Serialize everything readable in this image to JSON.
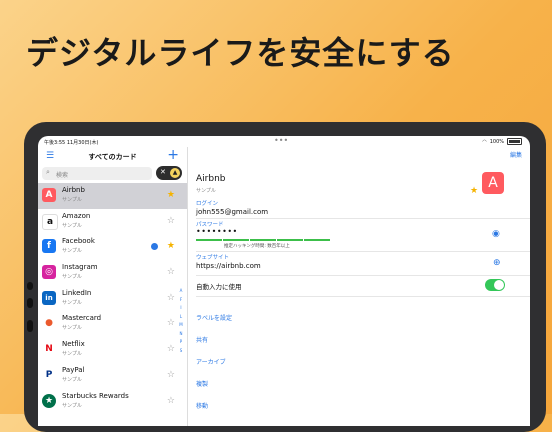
{
  "headline": "デジタルライフを安全にする",
  "status": {
    "time": "午後3:55  11月30日(木)",
    "battery": "100%"
  },
  "sidebar": {
    "title": "すべてのカード",
    "search_placeholder": "検索",
    "items": [
      {
        "name": "Airbnb",
        "sub": "サンプル",
        "logo": "A",
        "color": "#ff5a5f",
        "starred": true
      },
      {
        "name": "Amazon",
        "sub": "サンプル",
        "logo": "a",
        "color": "#111111",
        "starred": false
      },
      {
        "name": "Facebook",
        "sub": "サンプル",
        "logo": "f",
        "color": "#1877f2",
        "starred": true
      },
      {
        "name": "Instagram",
        "sub": "サンプル",
        "logo": "◎",
        "color": "#d6249f",
        "starred": false
      },
      {
        "name": "LinkedIn",
        "sub": "サンプル",
        "logo": "in",
        "color": "#0a66c2",
        "starred": false
      },
      {
        "name": "Mastercard",
        "sub": "サンプル",
        "logo": "●",
        "color": "#eb5a2d",
        "starred": false
      },
      {
        "name": "Netflix",
        "sub": "サンプル",
        "logo": "N",
        "color": "#e50914",
        "starred": false
      },
      {
        "name": "PayPal",
        "sub": "サンプル",
        "logo": "P",
        "color": "#003087",
        "starred": false
      },
      {
        "name": "Starbucks Rewards",
        "sub": "サンプル",
        "logo": "★",
        "color": "#00704a",
        "starred": false
      }
    ],
    "index": [
      "A",
      "F",
      "I",
      "L",
      "M",
      "N",
      "P",
      "S"
    ]
  },
  "detail": {
    "edit": "編集",
    "title": "Airbnb",
    "sub": "サンプル",
    "login_label": "ログイン",
    "login_value": "john555@gmail.com",
    "password_label": "パスワード",
    "password_value": "••••••••",
    "strength_note": "推定ハッキング時間: 数百年以上",
    "website_label": "ウェブサイト",
    "website_value": "https://airbnb.com",
    "autofill_label": "自動入力に使用",
    "autofill_on": true,
    "actions": [
      "ラベルを設定",
      "共有",
      "アーカイブ",
      "複製",
      "移動"
    ]
  }
}
